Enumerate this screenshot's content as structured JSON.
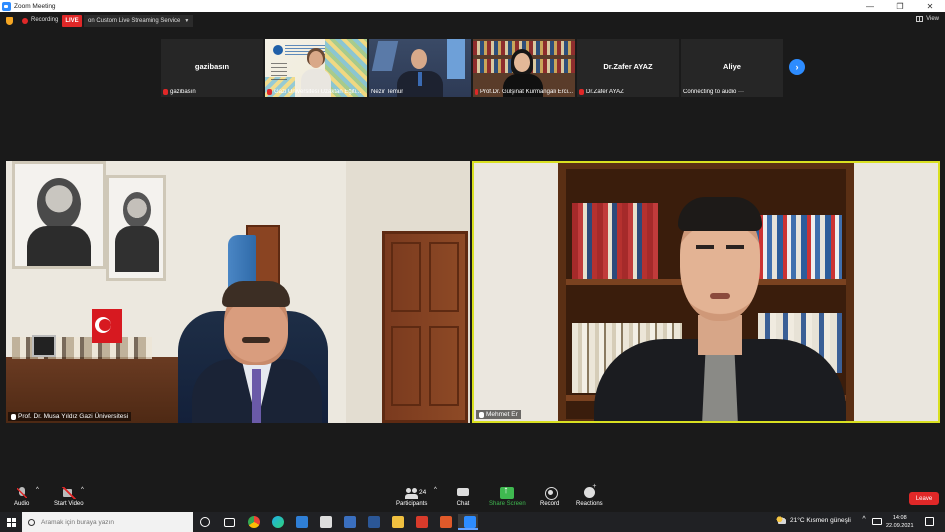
{
  "window": {
    "title": "Zoom Meeting",
    "controls": {
      "minimize": "—",
      "maximize": "❐",
      "close": "✕"
    }
  },
  "status": {
    "recording": "Recording",
    "live": "LIVE",
    "stream": "on Custom Live Streaming Service",
    "view": "View"
  },
  "thumbnails": [
    {
      "center_name": "gazibasın",
      "label": "gazibasın",
      "muted": true
    },
    {
      "center_name": "",
      "label": "Gazi Üniversitesi Uzaktan Eğiti...",
      "muted": true
    },
    {
      "center_name": "",
      "label": "Nezir Temur",
      "muted": false
    },
    {
      "center_name": "",
      "label": "Prof.Dr. Gülşinat Kurmangali Erci...",
      "muted": true
    },
    {
      "center_name": "Dr.Zafer AYAZ",
      "label": "Dr.Zafer AYAZ",
      "muted": true
    },
    {
      "center_name": "Aliye",
      "label": "Connecting to audio ···",
      "muted": false
    }
  ],
  "next_icon": "›",
  "main_videos": {
    "left_label": "Prof. Dr. Musa Yıldız Gazi Üniversitesi",
    "right_label": "Mehmet Er"
  },
  "toolbar": {
    "audio": "Audio",
    "start_video": "Start Video",
    "participants": "Participants",
    "participants_count": "24",
    "chat": "Chat",
    "share_screen": "Share Screen",
    "record": "Record",
    "reactions": "Reactions",
    "leave": "Leave",
    "caret": "^"
  },
  "colors": {
    "accent_blue": "#2d8cff",
    "live_red": "#e02828",
    "share_green": "#3fb950",
    "active_speaker": "#d9e021"
  },
  "taskbar": {
    "search_placeholder": "Aramak için buraya yazın",
    "weather": "21°C  Kısmen güneşli",
    "time": "14:08",
    "date": "22.09.2021",
    "tray_caret": "^",
    "apps": [
      "cortana-icon",
      "task-view-icon",
      "chrome-icon",
      "edge-icon",
      "store-icon",
      "calculator-icon",
      "word-icon",
      "file-explorer-icon",
      "acrobat-icon",
      "zoom-icon"
    ]
  }
}
